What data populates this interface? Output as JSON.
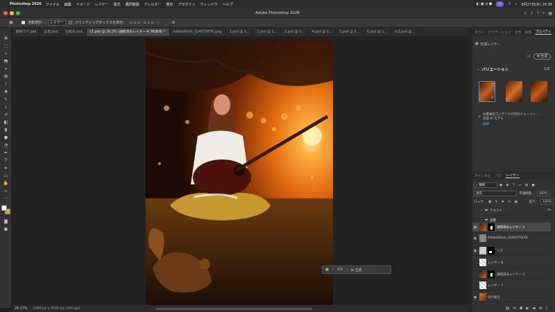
{
  "menubar": {
    "app": "Photoshop 2026",
    "items": [
      "ファイル",
      "編集",
      "イメージ",
      "レイヤー",
      "書式",
      "選択範囲",
      "フィルター",
      "表示",
      "プラグイン",
      "ウィンドウ",
      "ヘルプ"
    ],
    "datetime": "8月27日(木) 16:39"
  },
  "window": {
    "title": "Adobe Photoshop 2026"
  },
  "options": {
    "auto_select_label": "自動選択：",
    "auto_select_value": "レイヤー",
    "bbox_label": "バウンディングボックスを表示"
  },
  "tabs": [
    "肺革ラテ.psd",
    "広告.psd",
    "注意点.psd",
    "c1.psb @ 26.2% (調和済みレイヤー 4, RGB/8) *",
    "AdobeStock_524372876.jpeg",
    "1.psd @ 3...",
    "2.psd @ 3...",
    "3.psd @ 3...",
    "4.psd @ 3...",
    "5.psd @ 3...",
    "6.psd @ 3...",
    "cc3.psd @..."
  ],
  "status": {
    "zoom": "26.17%",
    "dims": "2480 px x 3508 px (300 ppi)"
  },
  "context_bar": {
    "pages": "1/3",
    "generate": "生成"
  },
  "panel_tabs_top": [
    "カラー",
    "グラデーション",
    "文字",
    "段落",
    "プロパティ"
  ],
  "properties": {
    "layer_type": "生成レイヤー",
    "generate": "生成",
    "variations_title": "バリエーション",
    "variations_count": "1/3",
    "notice": "お客様のコンテンツが次のトレーニン...",
    "notice2": "生成 AI モデル",
    "link": "詳細"
  },
  "layers_tabs": [
    "チャンネル",
    "パス",
    "レイヤー"
  ],
  "layers_options": {
    "kind": "種類",
    "blend": "通常",
    "opacity_label": "不透明度：",
    "opacity": "100%",
    "lock_label": "ロック：",
    "fill_label": "塗り：",
    "fill": "100%"
  },
  "layers": [
    {
      "name": "テキスト",
      "type": "group"
    },
    {
      "name": "調整",
      "type": "group"
    },
    {
      "name": "調和済みレイヤー 4",
      "type": "layer"
    },
    {
      "name": "AdobeStock_1505375476",
      "type": "layer"
    },
    {
      "name": "リス",
      "type": "layer"
    },
    {
      "name": "レイヤー 8",
      "type": "layer"
    },
    {
      "name": "調和済みレイヤー 3",
      "type": "layer"
    },
    {
      "name": "レイヤー 7",
      "type": "layer"
    },
    {
      "name": "切り抜き",
      "type": "layer"
    }
  ],
  "fx": "fx"
}
